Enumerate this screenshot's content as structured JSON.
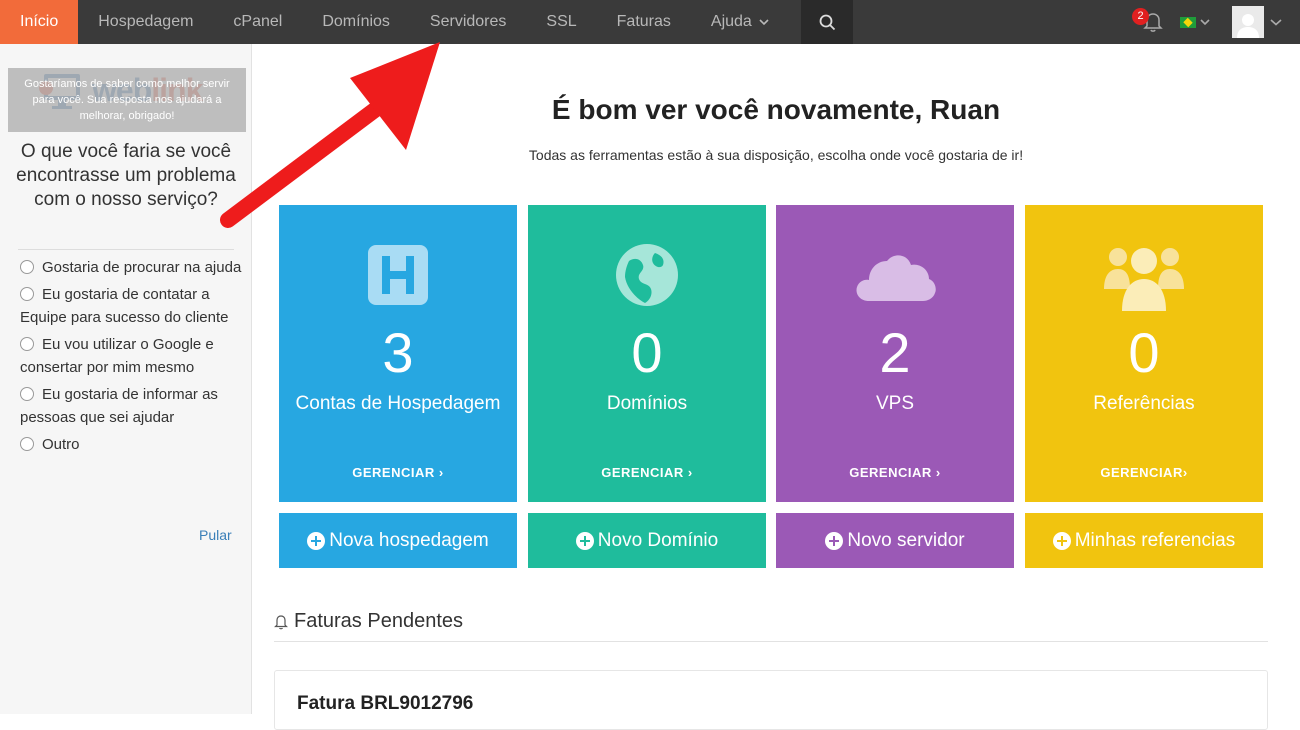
{
  "nav": {
    "items": [
      {
        "label": "Início",
        "active": true
      },
      {
        "label": "Hospedagem"
      },
      {
        "label": "cPanel"
      },
      {
        "label": "Domínios"
      },
      {
        "label": "Servidores"
      },
      {
        "label": "SSL"
      },
      {
        "label": "Faturas"
      },
      {
        "label": "Ajuda",
        "has_dropdown": true
      }
    ],
    "search_icon": "search-icon",
    "notifications_count": "2",
    "language": "Brazil flag",
    "colors": {
      "bar": "#3a3a3a",
      "active": "#f26b3a"
    }
  },
  "sidebar": {
    "logo": {
      "part1": "web",
      "part2": "link"
    },
    "tooltip": "Gostaríamos de saber como melhor servir para você. Sua resposta nos ajudará a melhorar, obrigado!",
    "question": "O que você faria se você encontrasse um problema com o nosso serviço?",
    "options": [
      "Gostaria de procurar na ajuda",
      "Eu gostaria de contatar a Equipe para sucesso do cliente",
      "Eu vou utilizar o Google e consertar por mim mesmo",
      "Eu gostaria de informar as pessoas que sei ajudar",
      "Outro"
    ],
    "skip_label": "Pular"
  },
  "main": {
    "greeting": "É bom ver você novamente, Ruan",
    "subtext": "Todas as ferramentas estão à sua disposição, escolha onde você gostaria de ir!",
    "tiles": [
      {
        "count": "3",
        "label": "Contas de Hospedagem",
        "manage": "GERENCIAR ›",
        "icon": "hosting-icon",
        "color": "#27a7e1"
      },
      {
        "count": "0",
        "label": "Domínios",
        "manage": "GERENCIAR ›",
        "icon": "globe-icon",
        "color": "#1fbc9c"
      },
      {
        "count": "2",
        "label": "VPS",
        "manage": "GERENCIAR ›",
        "icon": "cloud-icon",
        "color": "#9b59b6"
      },
      {
        "count": "0",
        "label": "Referências",
        "manage": "GERENCIAR›",
        "icon": "users-icon",
        "color": "#f1c40f"
      }
    ],
    "buttons": [
      {
        "label": "Nova hospedagem"
      },
      {
        "label": "Novo Domínio"
      },
      {
        "label": "Novo servidor"
      },
      {
        "label": "Minhas referencias"
      }
    ],
    "pending_title": "Faturas Pendentes",
    "invoice_title": "Fatura BRL9012796"
  }
}
